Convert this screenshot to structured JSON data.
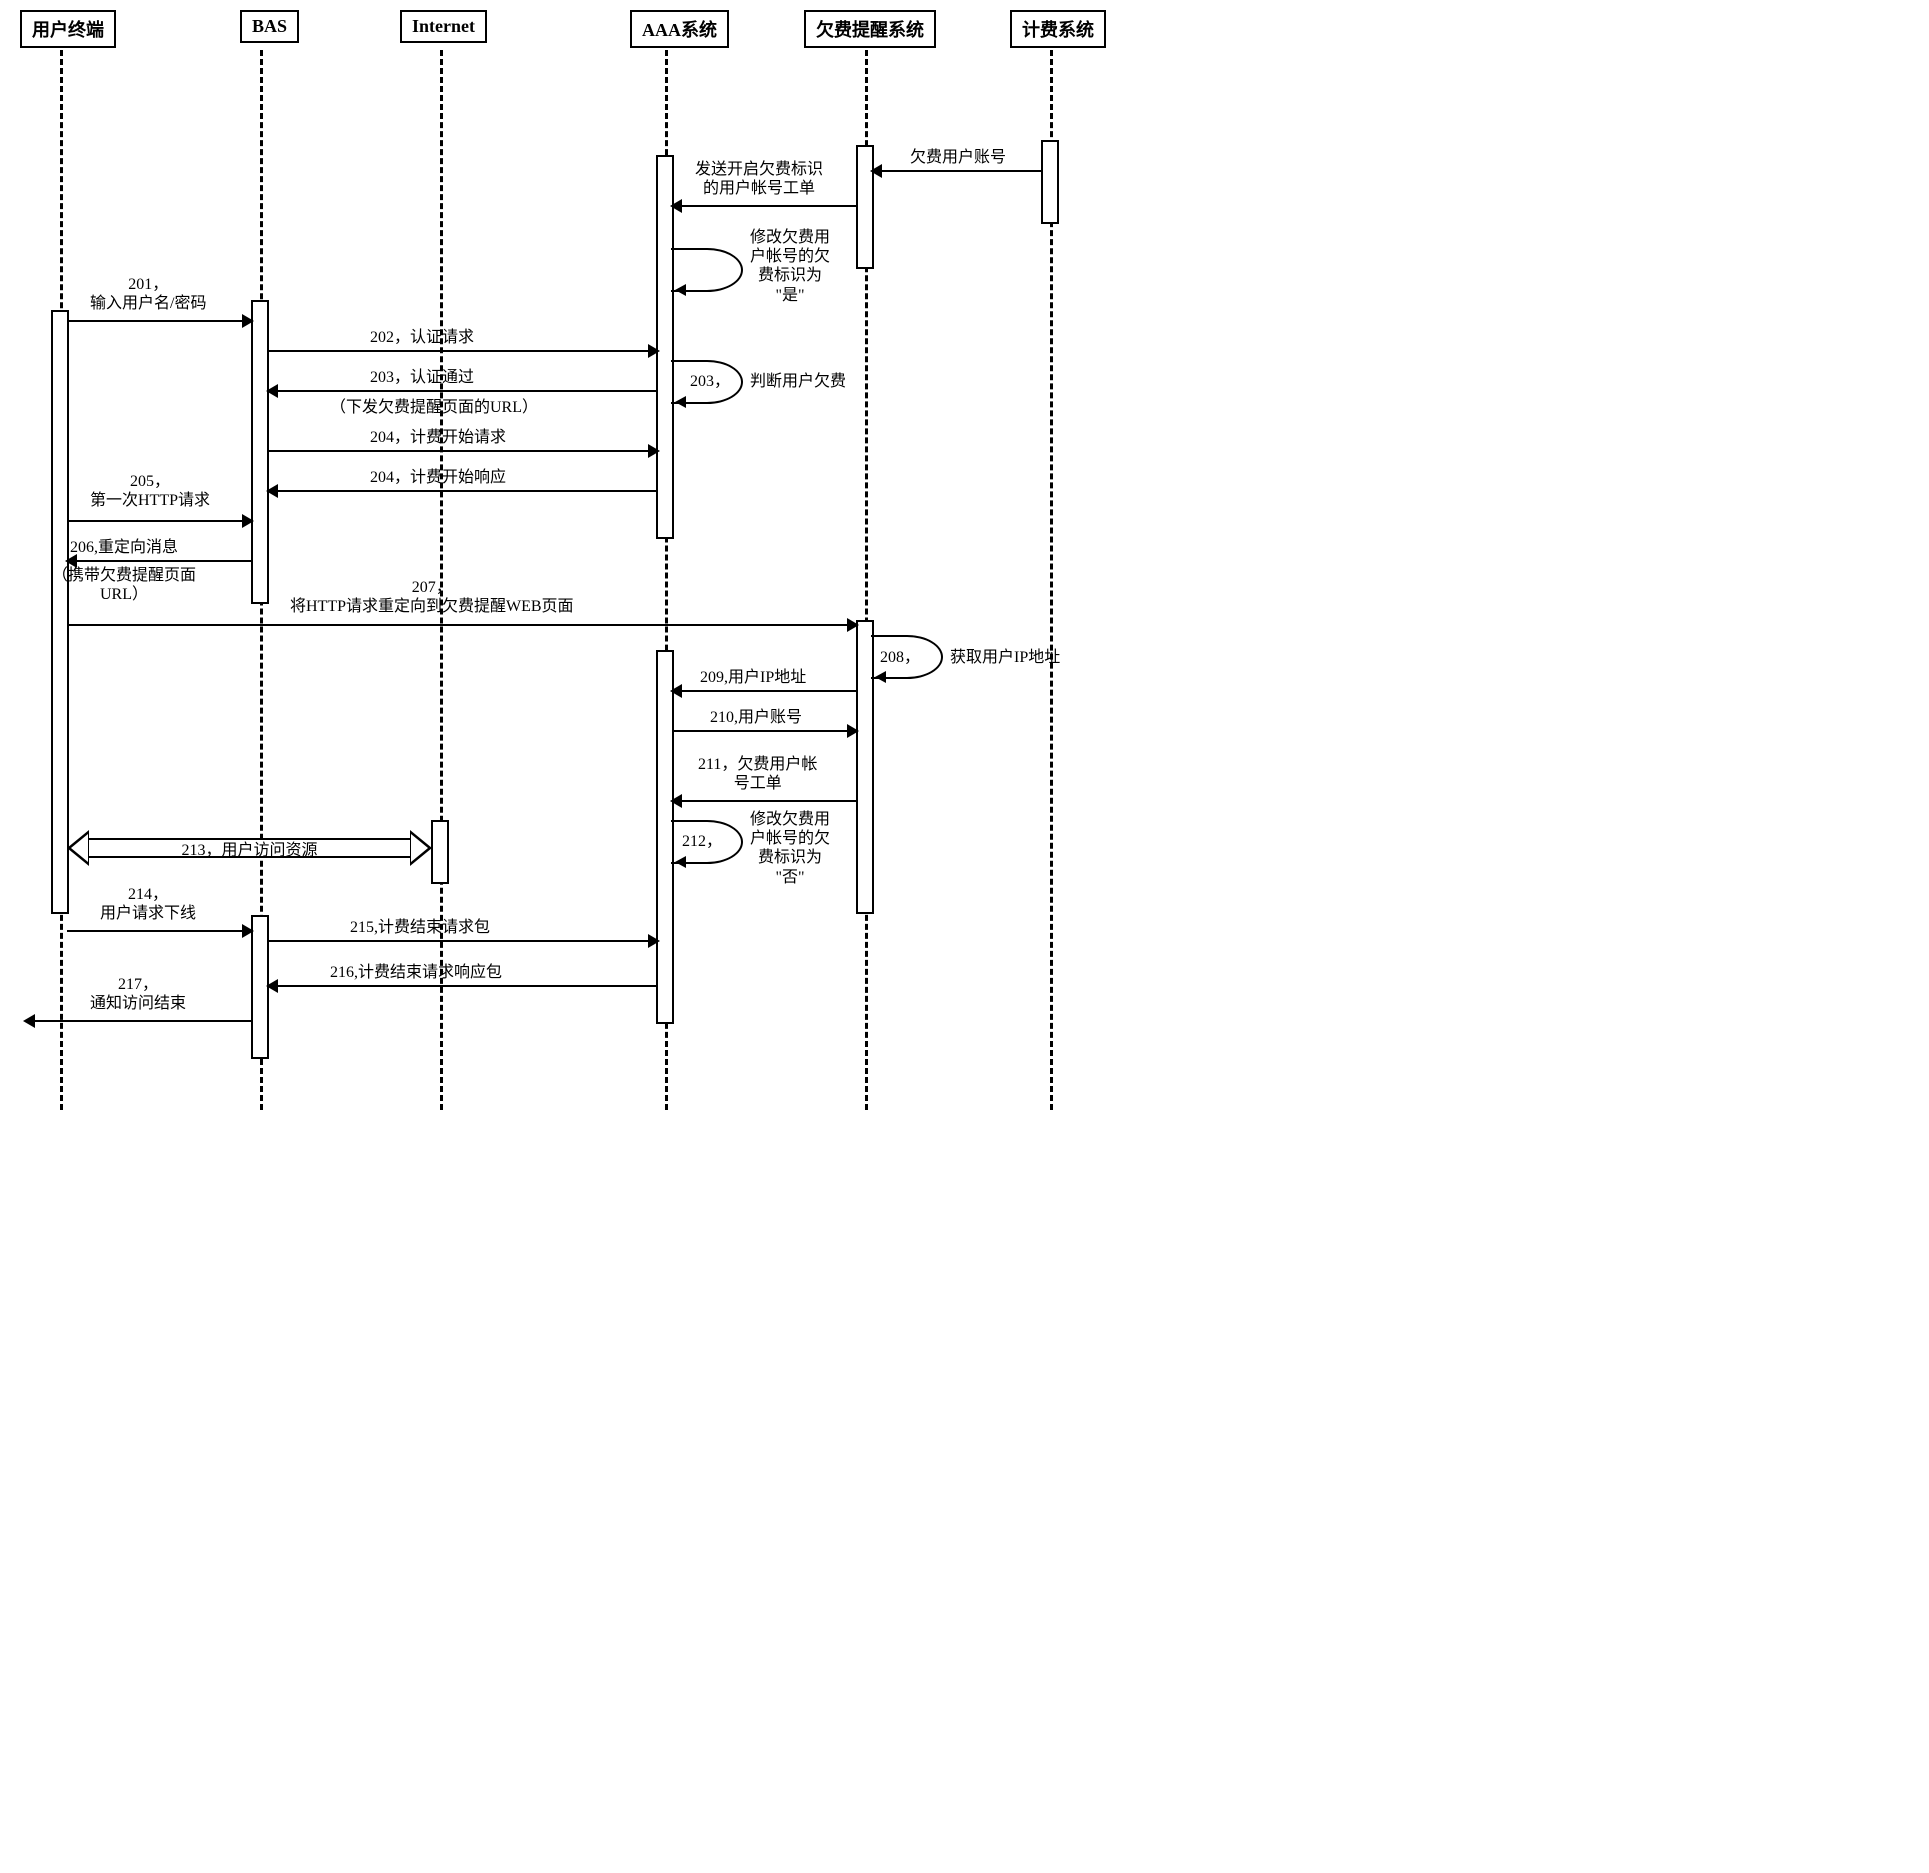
{
  "participants": {
    "user": "用户终端",
    "bas": "BAS",
    "internet": "Internet",
    "aaa": "AAA系统",
    "reminder": "欠费提醒系统",
    "billing": "计费系统"
  },
  "messages": {
    "m0a": "欠费用户账号",
    "m0b": "发送开启欠费标识\n的用户帐号工单",
    "loop1_num": "",
    "loop1_txt": "修改欠费用\n户帐号的欠\n费标识为\n\"是\"",
    "m201": "201，\n输入用户名/密码",
    "m202": "202，认证请求",
    "m203": "203，认证通过",
    "m203b": "（下发欠费提醒页面的URL）",
    "loop203_num": "203，",
    "loop203_txt": "判断用户欠费",
    "m204a": "204，计费开始请求",
    "m204b": "204，计费开始响应",
    "m205": "205，\n第一次HTTP请求",
    "m206": "206,重定向消息",
    "m206b": "（携带欠费提醒页面\nURL）",
    "m207": "207，\n将HTTP请求重定向到欠费提醒WEB页面",
    "loop208_num": "208，",
    "loop208_txt": "获取用户IP地址",
    "m209": "209,用户IP地址",
    "m210": "210,用户账号",
    "m211": "211，欠费用户帐\n号工单",
    "loop212_num": "212，",
    "loop212_txt": "修改欠费用\n户帐号的欠\n费标识为\n\"否\"",
    "m213": "213，用户访问资源",
    "m214": "214，\n用户请求下线",
    "m215": "215,计费结束请求包",
    "m216": "216,计费结束请求响应包",
    "m217": "217，\n通知访问结束"
  }
}
